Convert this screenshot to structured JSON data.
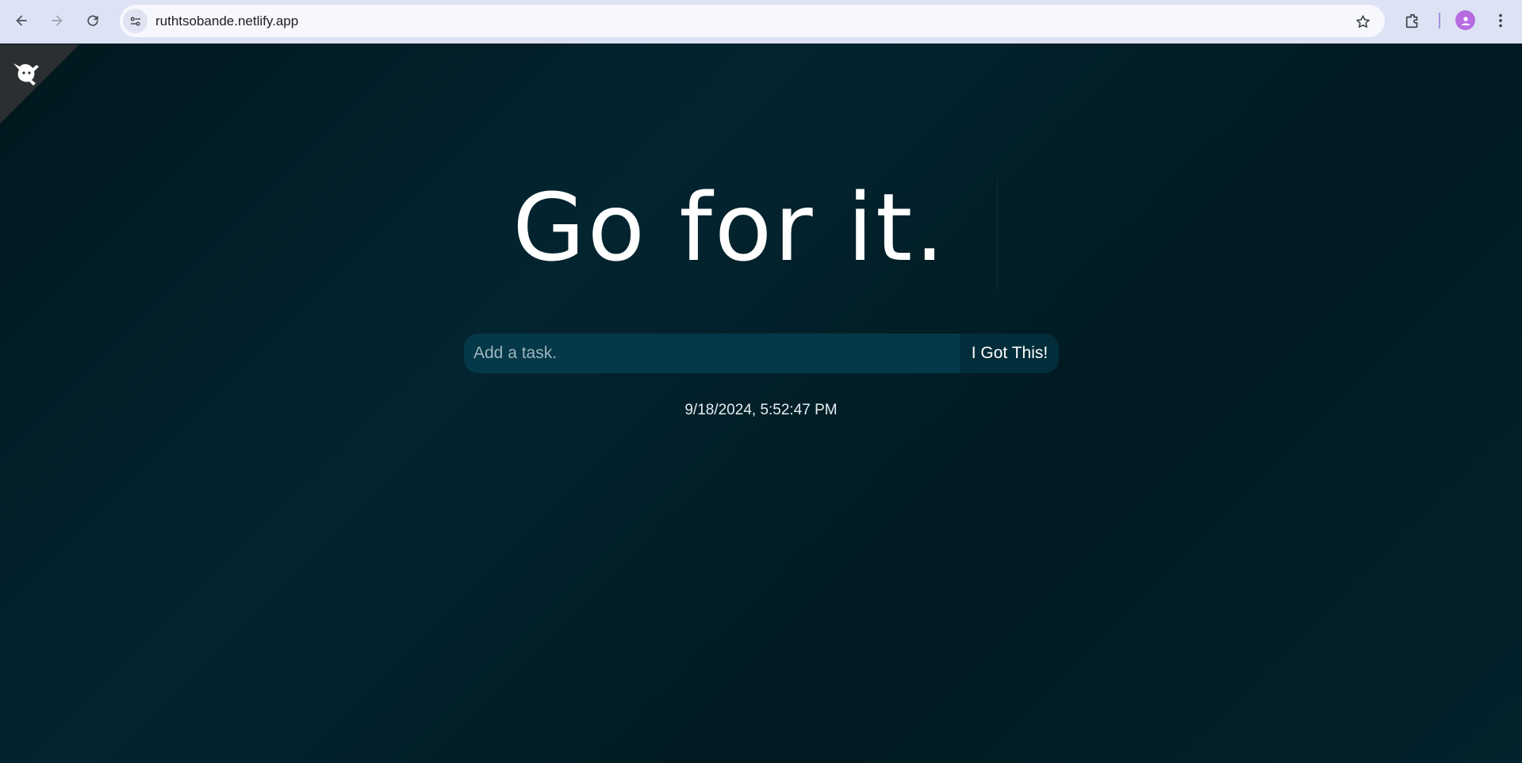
{
  "browser": {
    "url": "ruthtsobande.netlify.app",
    "icons": [
      "back-icon",
      "forward-icon",
      "reload-icon",
      "site-info-icon",
      "bookmark-star-icon",
      "extensions-icon",
      "profile-avatar",
      "menu-icon"
    ]
  },
  "page": {
    "headline": "Go for it.",
    "task_input": {
      "placeholder": "Add a task.",
      "value": ""
    },
    "submit_label": "I Got This!",
    "timestamp": "9/18/2024, 5:52:47 PM",
    "themes": [
      {
        "name": "standard",
        "color": "#27343a"
      },
      {
        "name": "light",
        "color": "#dbeeff"
      },
      {
        "name": "darker",
        "color": "#061115"
      }
    ],
    "github_corner_icon": "octocat-icon"
  }
}
